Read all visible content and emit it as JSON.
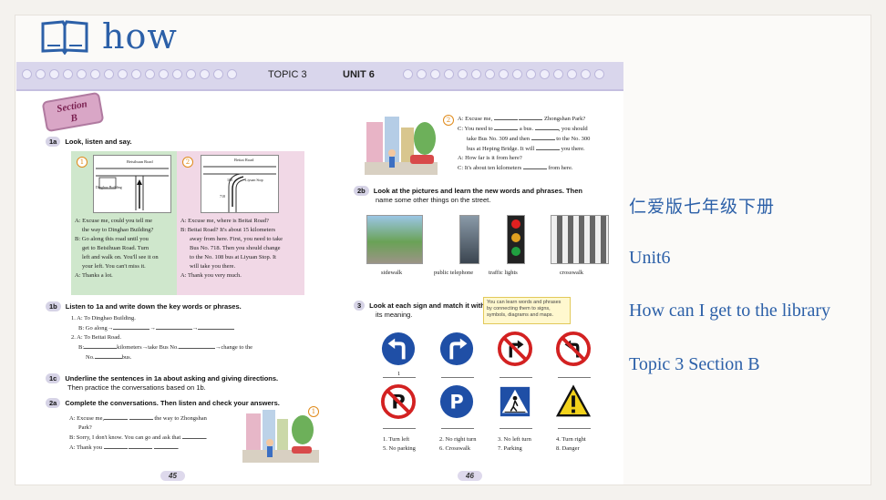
{
  "title": "how",
  "side_panel": {
    "line1": "仁爱版七年级下册",
    "line2": "Unit6",
    "line3": "How can I get to the library",
    "line4": "Topic 3 Section B"
  },
  "left_page": {
    "band_label": "TOPIC 3",
    "section_tag_line1": "Section",
    "section_tag_line2": "B",
    "ex1a": {
      "num": "1a",
      "title": "Look, listen and say."
    },
    "map1": {
      "circle": "1",
      "road": "Beisihuan Road",
      "building": "Dinghao Building",
      "dialog": [
        "A: Excuse me, could you tell me",
        "the way to Dinghao Building?",
        "B: Go along this road until you",
        "get to Beisihuan Road. Turn",
        "left and walk on. You'll see it on",
        "your left. You can't miss it.",
        "A: Thanks a lot."
      ]
    },
    "map2": {
      "circle": "2",
      "road": "Beitai Road",
      "stop": "Liyuan Stop",
      "bus": "108",
      "bus2": "718",
      "dialog": [
        "A: Excuse me, where is Beitai Road?",
        "B: Beitai Road? It's about 15 kilometers",
        "away from here. First, you need to take",
        "Bus No. 718. Then you should change",
        "to the No. 108 bus at Liyuan Stop. It",
        "will take you there.",
        "A: Thank you very much."
      ]
    },
    "ex1b": {
      "num": "1b",
      "title": "Listen to 1a and write down the key words or phrases.",
      "lines": [
        "1. A: To Dinghao Building.",
        "B: Go along→",
        "2. A: To Beitai Road.",
        "B:",
        "kilometers→take Bus No.",
        "→change to the",
        "No.",
        "bus."
      ]
    },
    "ex1c": {
      "num": "1c",
      "title": "Underline the sentences in 1a about asking and giving directions.",
      "title2": "Then practice the conversations based on 1b."
    },
    "ex2a": {
      "num": "2a",
      "title": "Complete the conversations. Then listen and check your answers.",
      "circle": "1",
      "lines": [
        "A: Excuse me,",
        "the way to Zhongshan",
        "Park?",
        "B: Sorry, I don't know. You can go and ask that",
        "A: Thank you"
      ]
    },
    "page_num": "45"
  },
  "right_page": {
    "band_label": "UNIT 6",
    "conv2": {
      "circle": "2",
      "lines": [
        "A: Excuse me,",
        "Zhongshan Park?",
        "C: You need to",
        "a bus.",
        ", you should",
        "take Bus No. 309 and then",
        "to the No. 300",
        "bus at Heping Bridge. It will",
        "you there.",
        "A: How far is it from here?",
        "C: It's about ten kilometers",
        "from here."
      ]
    },
    "ex2b": {
      "num": "2b",
      "title": "Look at the pictures and learn the new words and phrases. Then",
      "title2": "name some other things on the street.",
      "captions": [
        "sidewalk",
        "public telephone",
        "traffic lights",
        "crosswalk"
      ]
    },
    "ex3": {
      "num": "3",
      "title": "Look at each sign and match it with",
      "title2": "its meaning.",
      "tip": "You can learn words and phrases by connecting them to signs, symbols, diagrams and maps.",
      "first_answer": "1",
      "meanings": [
        "1. Turn left",
        "2. No right turn",
        "3. No left turn",
        "4. Turn right",
        "5. No parking",
        "6. Crosswalk",
        "7. Parking",
        "8. Danger"
      ]
    },
    "page_num": "46"
  },
  "colors": {
    "accent": "#2c60a8",
    "band": "#d9d6ec",
    "sign_blue": "#1f4fa6",
    "sign_red": "#d32121",
    "warn_yellow": "#f2d21b"
  }
}
